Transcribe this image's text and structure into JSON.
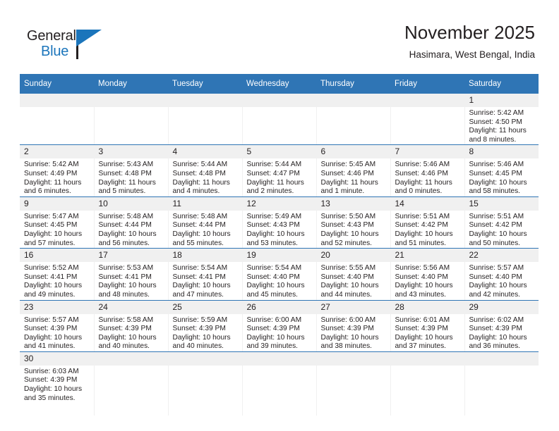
{
  "brand": {
    "word_one": "General",
    "word_two": "Blue",
    "accent_color": "#1b75bb",
    "text_color": "#231f20"
  },
  "header": {
    "title": "November 2025",
    "subtitle": "Hasimara, West Bengal, India"
  },
  "theme": {
    "header_row_bg": "#2f75b5",
    "day_number_bg": "#f0f0f0",
    "row_divider": "#2f75b5",
    "cell_bg": "#ffffff"
  },
  "weekdays": [
    "Sunday",
    "Monday",
    "Tuesday",
    "Wednesday",
    "Thursday",
    "Friday",
    "Saturday"
  ],
  "labels": {
    "sunrise_prefix": "Sunrise:",
    "sunset_prefix": "Sunset:",
    "daylight_prefix": "Daylight:"
  },
  "weeks": [
    [
      {
        "day": "",
        "empty": true
      },
      {
        "day": "",
        "empty": true
      },
      {
        "day": "",
        "empty": true
      },
      {
        "day": "",
        "empty": true
      },
      {
        "day": "",
        "empty": true
      },
      {
        "day": "",
        "empty": true
      },
      {
        "day": "1",
        "sunrise": "Sunrise: 5:42 AM",
        "sunset": "Sunset: 4:50 PM",
        "daylight1": "Daylight: 11 hours",
        "daylight2": "and 8 minutes."
      }
    ],
    [
      {
        "day": "2",
        "sunrise": "Sunrise: 5:42 AM",
        "sunset": "Sunset: 4:49 PM",
        "daylight1": "Daylight: 11 hours",
        "daylight2": "and 6 minutes."
      },
      {
        "day": "3",
        "sunrise": "Sunrise: 5:43 AM",
        "sunset": "Sunset: 4:48 PM",
        "daylight1": "Daylight: 11 hours",
        "daylight2": "and 5 minutes."
      },
      {
        "day": "4",
        "sunrise": "Sunrise: 5:44 AM",
        "sunset": "Sunset: 4:48 PM",
        "daylight1": "Daylight: 11 hours",
        "daylight2": "and 4 minutes."
      },
      {
        "day": "5",
        "sunrise": "Sunrise: 5:44 AM",
        "sunset": "Sunset: 4:47 PM",
        "daylight1": "Daylight: 11 hours",
        "daylight2": "and 2 minutes."
      },
      {
        "day": "6",
        "sunrise": "Sunrise: 5:45 AM",
        "sunset": "Sunset: 4:46 PM",
        "daylight1": "Daylight: 11 hours",
        "daylight2": "and 1 minute."
      },
      {
        "day": "7",
        "sunrise": "Sunrise: 5:46 AM",
        "sunset": "Sunset: 4:46 PM",
        "daylight1": "Daylight: 11 hours",
        "daylight2": "and 0 minutes."
      },
      {
        "day": "8",
        "sunrise": "Sunrise: 5:46 AM",
        "sunset": "Sunset: 4:45 PM",
        "daylight1": "Daylight: 10 hours",
        "daylight2": "and 58 minutes."
      }
    ],
    [
      {
        "day": "9",
        "sunrise": "Sunrise: 5:47 AM",
        "sunset": "Sunset: 4:45 PM",
        "daylight1": "Daylight: 10 hours",
        "daylight2": "and 57 minutes."
      },
      {
        "day": "10",
        "sunrise": "Sunrise: 5:48 AM",
        "sunset": "Sunset: 4:44 PM",
        "daylight1": "Daylight: 10 hours",
        "daylight2": "and 56 minutes."
      },
      {
        "day": "11",
        "sunrise": "Sunrise: 5:48 AM",
        "sunset": "Sunset: 4:44 PM",
        "daylight1": "Daylight: 10 hours",
        "daylight2": "and 55 minutes."
      },
      {
        "day": "12",
        "sunrise": "Sunrise: 5:49 AM",
        "sunset": "Sunset: 4:43 PM",
        "daylight1": "Daylight: 10 hours",
        "daylight2": "and 53 minutes."
      },
      {
        "day": "13",
        "sunrise": "Sunrise: 5:50 AM",
        "sunset": "Sunset: 4:43 PM",
        "daylight1": "Daylight: 10 hours",
        "daylight2": "and 52 minutes."
      },
      {
        "day": "14",
        "sunrise": "Sunrise: 5:51 AM",
        "sunset": "Sunset: 4:42 PM",
        "daylight1": "Daylight: 10 hours",
        "daylight2": "and 51 minutes."
      },
      {
        "day": "15",
        "sunrise": "Sunrise: 5:51 AM",
        "sunset": "Sunset: 4:42 PM",
        "daylight1": "Daylight: 10 hours",
        "daylight2": "and 50 minutes."
      }
    ],
    [
      {
        "day": "16",
        "sunrise": "Sunrise: 5:52 AM",
        "sunset": "Sunset: 4:41 PM",
        "daylight1": "Daylight: 10 hours",
        "daylight2": "and 49 minutes."
      },
      {
        "day": "17",
        "sunrise": "Sunrise: 5:53 AM",
        "sunset": "Sunset: 4:41 PM",
        "daylight1": "Daylight: 10 hours",
        "daylight2": "and 48 minutes."
      },
      {
        "day": "18",
        "sunrise": "Sunrise: 5:54 AM",
        "sunset": "Sunset: 4:41 PM",
        "daylight1": "Daylight: 10 hours",
        "daylight2": "and 47 minutes."
      },
      {
        "day": "19",
        "sunrise": "Sunrise: 5:54 AM",
        "sunset": "Sunset: 4:40 PM",
        "daylight1": "Daylight: 10 hours",
        "daylight2": "and 45 minutes."
      },
      {
        "day": "20",
        "sunrise": "Sunrise: 5:55 AM",
        "sunset": "Sunset: 4:40 PM",
        "daylight1": "Daylight: 10 hours",
        "daylight2": "and 44 minutes."
      },
      {
        "day": "21",
        "sunrise": "Sunrise: 5:56 AM",
        "sunset": "Sunset: 4:40 PM",
        "daylight1": "Daylight: 10 hours",
        "daylight2": "and 43 minutes."
      },
      {
        "day": "22",
        "sunrise": "Sunrise: 5:57 AM",
        "sunset": "Sunset: 4:40 PM",
        "daylight1": "Daylight: 10 hours",
        "daylight2": "and 42 minutes."
      }
    ],
    [
      {
        "day": "23",
        "sunrise": "Sunrise: 5:57 AM",
        "sunset": "Sunset: 4:39 PM",
        "daylight1": "Daylight: 10 hours",
        "daylight2": "and 41 minutes."
      },
      {
        "day": "24",
        "sunrise": "Sunrise: 5:58 AM",
        "sunset": "Sunset: 4:39 PM",
        "daylight1": "Daylight: 10 hours",
        "daylight2": "and 40 minutes."
      },
      {
        "day": "25",
        "sunrise": "Sunrise: 5:59 AM",
        "sunset": "Sunset: 4:39 PM",
        "daylight1": "Daylight: 10 hours",
        "daylight2": "and 40 minutes."
      },
      {
        "day": "26",
        "sunrise": "Sunrise: 6:00 AM",
        "sunset": "Sunset: 4:39 PM",
        "daylight1": "Daylight: 10 hours",
        "daylight2": "and 39 minutes."
      },
      {
        "day": "27",
        "sunrise": "Sunrise: 6:00 AM",
        "sunset": "Sunset: 4:39 PM",
        "daylight1": "Daylight: 10 hours",
        "daylight2": "and 38 minutes."
      },
      {
        "day": "28",
        "sunrise": "Sunrise: 6:01 AM",
        "sunset": "Sunset: 4:39 PM",
        "daylight1": "Daylight: 10 hours",
        "daylight2": "and 37 minutes."
      },
      {
        "day": "29",
        "sunrise": "Sunrise: 6:02 AM",
        "sunset": "Sunset: 4:39 PM",
        "daylight1": "Daylight: 10 hours",
        "daylight2": "and 36 minutes."
      }
    ],
    [
      {
        "day": "30",
        "sunrise": "Sunrise: 6:03 AM",
        "sunset": "Sunset: 4:39 PM",
        "daylight1": "Daylight: 10 hours",
        "daylight2": "and 35 minutes."
      },
      {
        "day": "",
        "empty": true
      },
      {
        "day": "",
        "empty": true
      },
      {
        "day": "",
        "empty": true
      },
      {
        "day": "",
        "empty": true
      },
      {
        "day": "",
        "empty": true
      },
      {
        "day": "",
        "empty": true
      }
    ]
  ]
}
